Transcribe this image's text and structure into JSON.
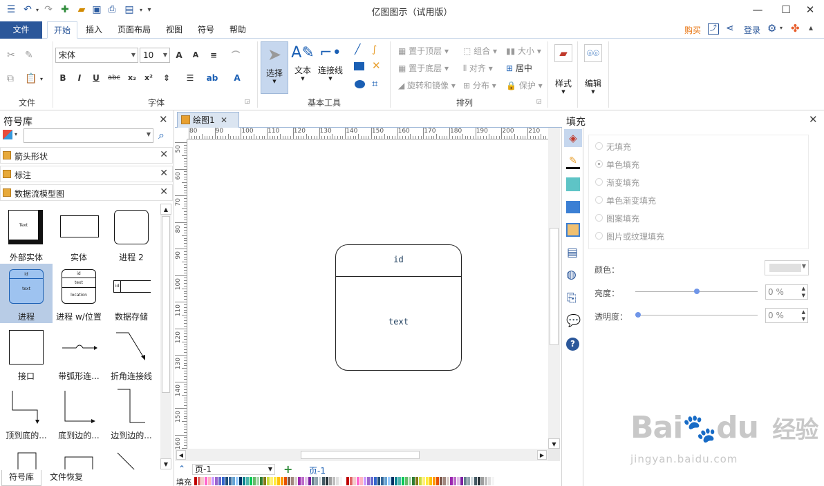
{
  "window": {
    "title": "亿图图示（试用版）"
  },
  "menu": {
    "file": "文件",
    "tabs": [
      "开始",
      "插入",
      "页面布局",
      "视图",
      "符号",
      "帮助"
    ],
    "right": {
      "buy": "购买",
      "login": "登录"
    }
  },
  "ribbon": {
    "groups": {
      "file": "文件",
      "font": "字体",
      "basic_tools": "基本工具",
      "arrange": "排列"
    },
    "font_name": "宋体",
    "font_size": "10",
    "tools": {
      "select": "选择",
      "text": "文本",
      "connector": "连接线"
    },
    "arrange": {
      "bring_front": "置于顶层",
      "group": "组合",
      "size": "大小",
      "send_back": "置于底层",
      "align": "对齐",
      "center": "居中",
      "rotate_mirror": "旋转和镜像",
      "distribute": "分布",
      "protect": "保护"
    },
    "style": "样式",
    "edit": "编辑"
  },
  "library": {
    "title": "符号库",
    "search_placeholder": "",
    "sections": [
      "箭头形状",
      "标注",
      "数据流模型图"
    ],
    "shapes": [
      {
        "label": "外部实体",
        "glyph": "Text"
      },
      {
        "label": "实体"
      },
      {
        "label": "进程 2"
      },
      {
        "label": "进程",
        "t1": "id",
        "t2": "text"
      },
      {
        "label": "进程 w/位置",
        "t1": "id",
        "t2": "text",
        "t3": "location"
      },
      {
        "label": "数据存储",
        "t1": "id"
      },
      {
        "label": "接口"
      },
      {
        "label": "带弧形连..."
      },
      {
        "label": "折角连接线"
      },
      {
        "label": "顶到底的..."
      },
      {
        "label": "底到边的..."
      },
      {
        "label": "边到边的..."
      }
    ],
    "bottom_tabs": [
      "符号库",
      "文件恢复"
    ]
  },
  "document": {
    "tab": "绘图1",
    "hruler": [
      "80",
      "90",
      "100",
      "110",
      "120",
      "130",
      "140",
      "150",
      "160",
      "170",
      "180",
      "190",
      "200",
      "210"
    ],
    "vruler": [
      "50",
      "60",
      "70",
      "80",
      "90",
      "100",
      "110",
      "120",
      "130",
      "140",
      "150",
      "160"
    ],
    "shape": {
      "id_text": "id",
      "body_text": "text"
    },
    "page_selector": "页-1",
    "page_tab": "页-1",
    "color_label": "填充"
  },
  "fill_panel": {
    "title": "填充",
    "options": [
      "无填充",
      "单色填充",
      "渐变填充",
      "单色渐变填充",
      "图案填充",
      "图片或纹理填充"
    ],
    "selected_index": 1,
    "color_label": "颜色：",
    "brightness_label": "亮度：",
    "brightness_value": "0 %",
    "transparency_label": "透明度：",
    "transparency_value": "0 %"
  },
  "watermark": {
    "brand": "Bai",
    "brand2": "du",
    "cn": "经验",
    "url": "jingyan.baidu.com"
  },
  "colors": {
    "accent": "#2b579a",
    "buy": "#e8710a",
    "selection": "#b8cce6",
    "palette": [
      "#c00000",
      "#e06666",
      "#f4cccc",
      "#ff66cc",
      "#ffb6c1",
      "#cc99ff",
      "#9966cc",
      "#6666cc",
      "#3366cc",
      "#1f4e79",
      "#336699",
      "#66a3d2",
      "#99ccff",
      "#003366",
      "#00838f",
      "#4db6ac",
      "#00c853",
      "#66bb6a",
      "#a5d6a7",
      "#2e7d32",
      "#827717",
      "#cddc39",
      "#fff176",
      "#ffeb3b",
      "#ffc107",
      "#ff9800",
      "#e65100",
      "#795548",
      "#a1887f",
      "#d7ccc8",
      "#9c27b0",
      "#ba68c8",
      "#e1bee7",
      "#7b1fa2",
      "#607d8b",
      "#90a4ae",
      "#cfd8dc",
      "#455a64",
      "#263238",
      "#9e9e9e",
      "#bdbdbd",
      "#e0e0e0",
      "#f5f5f5",
      "#ffffff"
    ]
  }
}
